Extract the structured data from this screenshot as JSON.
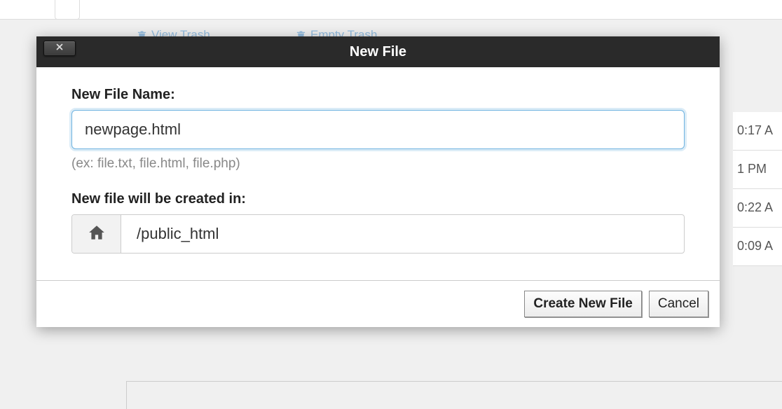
{
  "bg": {
    "view_trash": "View Trash",
    "empty_trash": "Empty Trash",
    "times": [
      "0:17 A",
      "1 PM",
      "0:22 A",
      "0:09 A"
    ]
  },
  "modal": {
    "title": "New File",
    "name_label": "New File Name:",
    "name_value": "newpage.html",
    "name_hint": "(ex: file.txt, file.html, file.php)",
    "location_label": "New file will be created in:",
    "location_path": "/public_html",
    "create_label": "Create New File",
    "cancel_label": "Cancel"
  }
}
